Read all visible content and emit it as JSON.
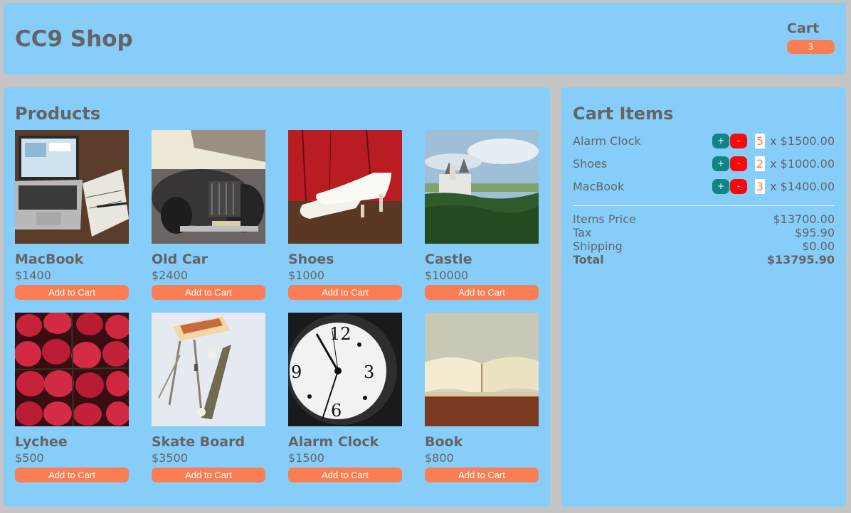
{
  "header": {
    "title": "CC9 Shop",
    "cart_label": "Cart",
    "cart_count": "3"
  },
  "products": {
    "title": "Products",
    "items": [
      {
        "name": "MacBook",
        "price": "$1400",
        "button": "Add to Cart",
        "icon": "laptop-photo"
      },
      {
        "name": "Old Car",
        "price": "$2400",
        "button": "Add to Cart",
        "icon": "old-car-photo"
      },
      {
        "name": "Shoes",
        "price": "$1000",
        "button": "Add to Cart",
        "icon": "white-shoes-photo"
      },
      {
        "name": "Castle",
        "price": "$10000",
        "button": "Add to Cart",
        "icon": "castle-photo"
      },
      {
        "name": "Lychee",
        "price": "$500",
        "button": "Add to Cart",
        "icon": "strawberries-photo"
      },
      {
        "name": "Skate Board",
        "price": "$3500",
        "button": "Add to Cart",
        "icon": "skateboard-photo"
      },
      {
        "name": "Alarm Clock",
        "price": "$1500",
        "button": "Add to Cart",
        "icon": "clock-photo"
      },
      {
        "name": "Book",
        "price": "$800",
        "button": "Add to Cart",
        "icon": "book-photo"
      }
    ]
  },
  "cart": {
    "title": "Cart Items",
    "items": [
      {
        "name": "Alarm Clock",
        "qty": "5",
        "price": "x $1500.00",
        "plus": "+",
        "minus": "-"
      },
      {
        "name": "Shoes",
        "qty": "2",
        "price": "x $1000.00",
        "plus": "+",
        "minus": "-"
      },
      {
        "name": "MacBook",
        "qty": "3",
        "price": "x $1400.00",
        "plus": "+",
        "minus": "-"
      }
    ],
    "summary": {
      "items_price_label": "Items Price",
      "items_price": "$13700.00",
      "tax_label": "Tax",
      "tax": "$95.90",
      "shipping_label": "Shipping",
      "shipping": "$0.00",
      "total_label": "Total",
      "total": "$13795.90"
    }
  },
  "colors": {
    "background": "#c4c4c4",
    "panel": "#87cdfa",
    "text": "#646464",
    "accent": "#fb7d53",
    "plus_button": "#0f8585",
    "minus_button": "#f90a0a"
  }
}
